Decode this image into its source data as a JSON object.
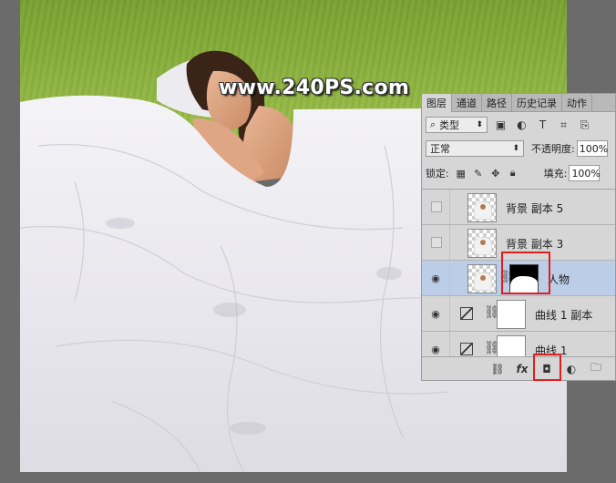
{
  "canvas": {
    "watermark": "www.240PS.com"
  },
  "layers_panel": {
    "tabs": [
      "图层",
      "通道",
      "路径",
      "历史记录",
      "动作"
    ],
    "active_tab": "图层",
    "filter_label": "类型",
    "blend_mode": "正常",
    "opacity_label": "不透明度:",
    "opacity_value": "100%",
    "lock_label": "锁定:",
    "fill_label": "填充:",
    "fill_value": "100%",
    "layers": [
      {
        "name": "背景 副本 5",
        "visible": false,
        "selected": false
      },
      {
        "name": "背景 副本 3",
        "visible": false,
        "selected": false
      },
      {
        "name": "人物",
        "visible": true,
        "selected": true
      },
      {
        "name": "曲线 1 副本",
        "visible": true,
        "selected": false
      },
      {
        "name": "曲线 1",
        "visible": true,
        "selected": false
      }
    ]
  },
  "colors": {
    "highlight_red": "#e11e1e",
    "selected_layer": "#bccde8",
    "panel_bg": "#d6d6d6"
  }
}
